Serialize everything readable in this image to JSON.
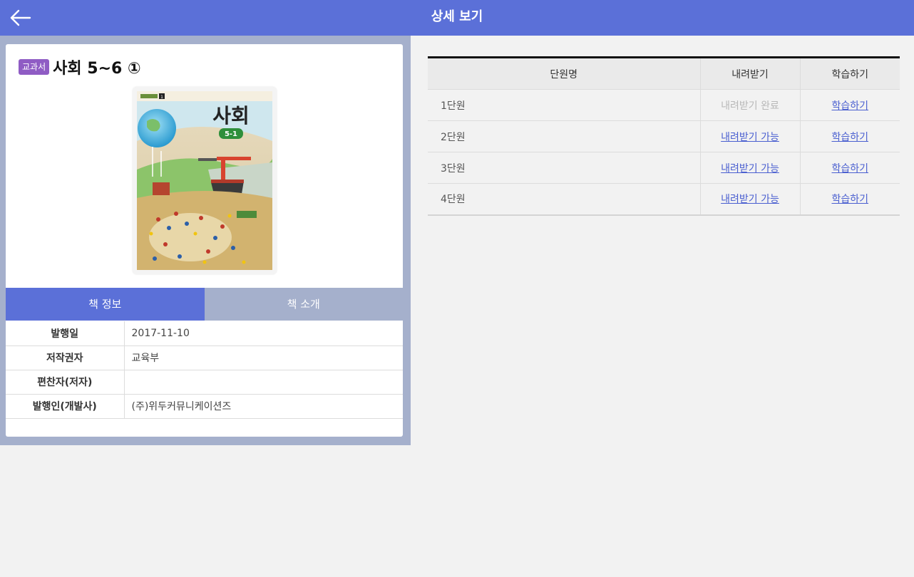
{
  "header": {
    "title": "상세 보기",
    "back_icon": "arrow-left-icon"
  },
  "book": {
    "badge": "교과서",
    "title": "사회 5~6 ①",
    "cover": {
      "title": "사회",
      "volume": "5-1",
      "top_mark": "1"
    }
  },
  "tabs": [
    {
      "label": "책 정보",
      "active": true
    },
    {
      "label": "책 소개",
      "active": false
    }
  ],
  "info": [
    {
      "key": "발행일",
      "value": "2017-11-10"
    },
    {
      "key": "저작권자",
      "value": "교육부"
    },
    {
      "key": "편찬자(저자)",
      "value": ""
    },
    {
      "key": "발행인(개발사)",
      "value": "(주)위두커뮤니케이션즈"
    }
  ],
  "units_table": {
    "headers": [
      "단원명",
      "내려받기",
      "학습하기"
    ],
    "rows": [
      {
        "name": "1단원",
        "download": "내려받기 완료",
        "downloaded": true,
        "study": "학습하기"
      },
      {
        "name": "2단원",
        "download": "내려받기 가능",
        "downloaded": false,
        "study": "학습하기"
      },
      {
        "name": "3단원",
        "download": "내려받기 가능",
        "downloaded": false,
        "study": "학습하기"
      },
      {
        "name": "4단원",
        "download": "내려받기 가능",
        "downloaded": false,
        "study": "학습하기"
      }
    ]
  },
  "colors": {
    "primary": "#5b70d8",
    "panel": "#a5b0cc",
    "badge": "#8f5cc4",
    "link": "#4a5fd0"
  }
}
